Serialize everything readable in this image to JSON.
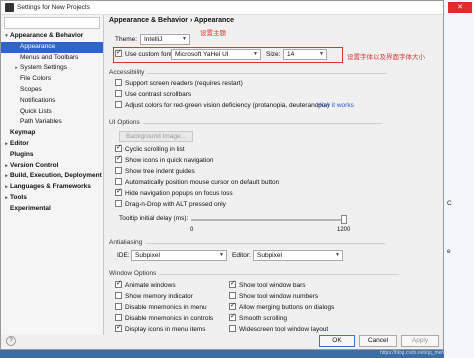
{
  "window": {
    "title": "Settings for New Projects"
  },
  "sidebar": {
    "items": [
      {
        "label": "Appearance & Behavior",
        "arrow": "▾",
        "bold": true,
        "indent": 2
      },
      {
        "label": "Appearance",
        "arrow": "",
        "bold": false,
        "indent": 12,
        "selected": true
      },
      {
        "label": "Menus and Toolbars",
        "arrow": "",
        "bold": false,
        "indent": 12
      },
      {
        "label": "System Settings",
        "arrow": "▸",
        "bold": false,
        "indent": 12
      },
      {
        "label": "File Colors",
        "arrow": "",
        "bold": false,
        "indent": 12
      },
      {
        "label": "Scopes",
        "arrow": "",
        "bold": false,
        "indent": 12
      },
      {
        "label": "Notifications",
        "arrow": "",
        "bold": false,
        "indent": 12
      },
      {
        "label": "Quick Lists",
        "arrow": "",
        "bold": false,
        "indent": 12
      },
      {
        "label": "Path Variables",
        "arrow": "",
        "bold": false,
        "indent": 12
      },
      {
        "label": "Keymap",
        "arrow": "",
        "bold": true,
        "indent": 2
      },
      {
        "label": "Editor",
        "arrow": "▸",
        "bold": true,
        "indent": 2
      },
      {
        "label": "Plugins",
        "arrow": "",
        "bold": true,
        "indent": 2
      },
      {
        "label": "Version Control",
        "arrow": "▸",
        "bold": true,
        "indent": 2
      },
      {
        "label": "Build, Execution, Deployment",
        "arrow": "▸",
        "bold": true,
        "indent": 2
      },
      {
        "label": "Languages & Frameworks",
        "arrow": "▸",
        "bold": true,
        "indent": 2
      },
      {
        "label": "Tools",
        "arrow": "▸",
        "bold": true,
        "indent": 2
      },
      {
        "label": "Experimental",
        "arrow": "",
        "bold": true,
        "indent": 2
      }
    ]
  },
  "breadcrumb": {
    "part1": "Appearance & Behavior",
    "sep": "›",
    "part2": "Appearance"
  },
  "theme": {
    "label": "Theme:",
    "value": "IntelliJ",
    "annotation": "设置主题"
  },
  "font": {
    "checkbox_label": "Use custom font:",
    "value": "Microsoft YaHei UI",
    "size_label": "Size:",
    "size_value": "14",
    "annotation": "设置字体以及界面字体大小"
  },
  "accessibility": {
    "title": "Accessibility",
    "support_screen_readers": "Support screen readers (requires restart)",
    "contrast_scrollbars": "Use contrast scrollbars",
    "adjust_colors": "Adjust colors for red-green vision deficiency (protanopia, deuteranopia)",
    "how_it_works": "How it works"
  },
  "ui_options": {
    "title": "UI Options",
    "background_image": "Background Image...",
    "cyclic": "Cyclic scrolling in list",
    "show_icons": "Show icons in quick navigation",
    "show_tree": "Show tree indent guides",
    "auto_position": "Automatically position mouse cursor on default button",
    "hide_popups": "Hide navigation popups on focus loss",
    "drag_drop": "Drag-n-Drop with ALT pressed only",
    "tooltip_label": "Tooltip initial delay (ms):",
    "tooltip_min": "0",
    "tooltip_max": "1200",
    "tooltip_value": 1200
  },
  "antialiasing": {
    "title": "Antialiasing",
    "ide_label": "IDE:",
    "ide_value": "Subpixel",
    "editor_label": "Editor:",
    "editor_value": "Subpixel"
  },
  "window_options": {
    "title": "Window Options",
    "left": [
      "Animate windows",
      "Show memory indicator",
      "Disable mnemonics in menu",
      "Disable mnemonics in controls",
      "Display icons in menu items"
    ],
    "right": [
      "Show tool window bars",
      "Show tool window numbers",
      "Allow merging buttons on dialogs",
      "Smooth scrolling",
      "Widescreen tool window layout"
    ]
  },
  "buttons": {
    "help": "?",
    "ok": "OK",
    "cancel": "Cancel",
    "apply": "Apply"
  },
  "right_strip": {
    "close": "✕",
    "item1": "C",
    "item2": "e"
  },
  "footnote": "https://blog.csdn.net/qq_mehe"
}
